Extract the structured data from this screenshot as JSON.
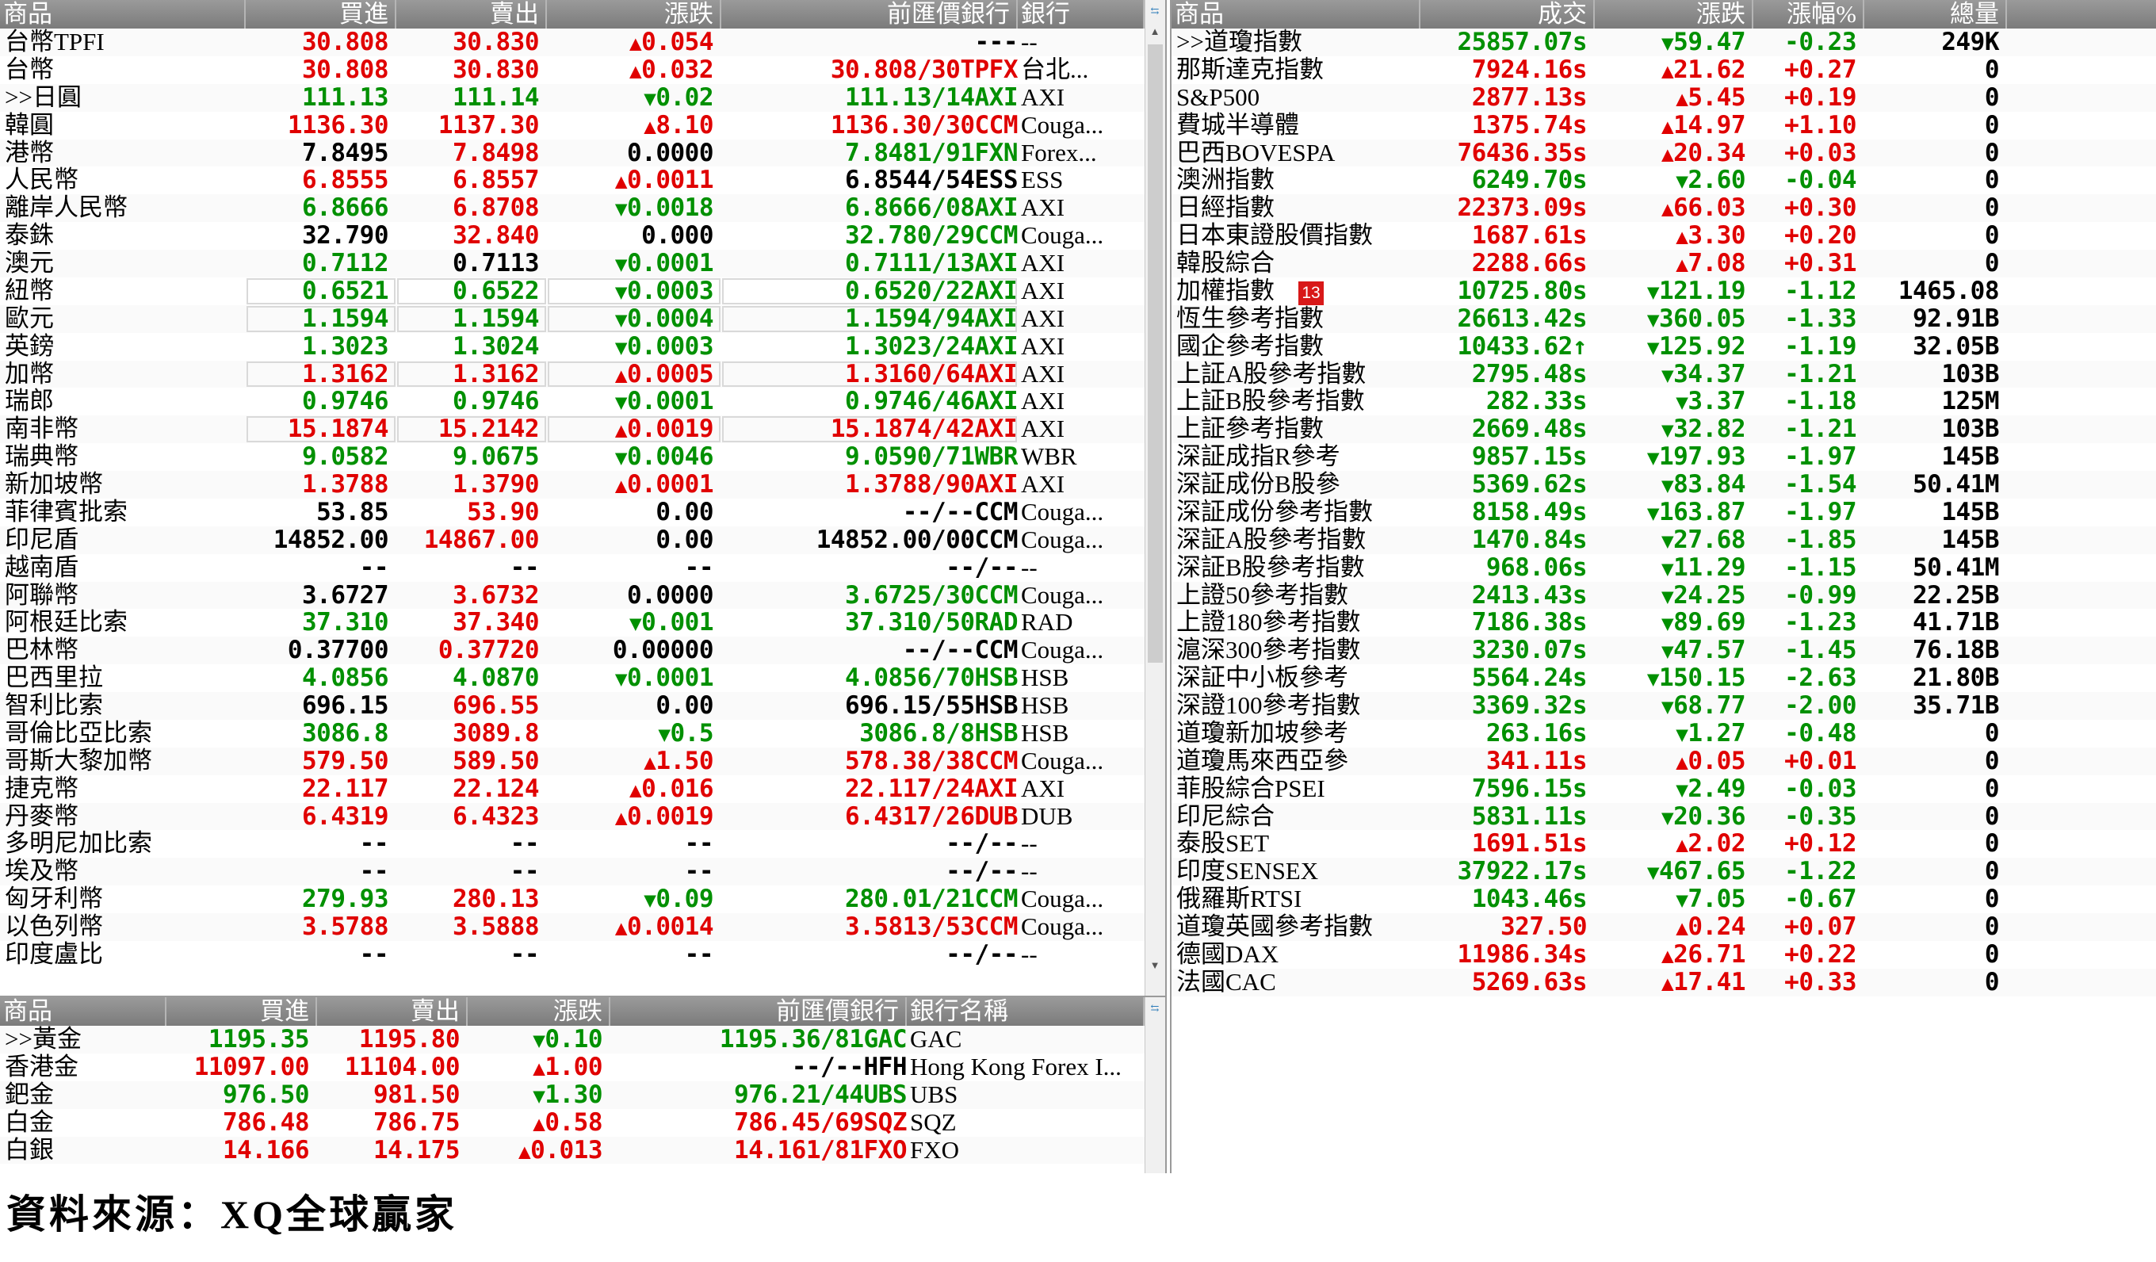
{
  "fx_panel": {
    "headers": {
      "name": "商品",
      "bid": "買進",
      "ask": "賣出",
      "change": "漲跌",
      "prev": "前匯價銀行",
      "bank": "銀行"
    },
    "rows": [
      {
        "name": "台幣TPFI",
        "bid": "30.808",
        "ask": "30.830",
        "chg": "0.054",
        "dir": "up",
        "prev": "---",
        "bank": "--",
        "bidc": "up",
        "askc": "up",
        "prevc": "fl"
      },
      {
        "name": "台幣",
        "bid": "30.808",
        "ask": "30.830",
        "chg": "0.032",
        "dir": "up",
        "prev": "30.808/30TPFX",
        "bank": "台北...",
        "bidc": "up",
        "askc": "up",
        "prevc": "up"
      },
      {
        "name": ">>日圓",
        "bid": "111.13",
        "ask": "111.14",
        "chg": "0.02",
        "dir": "dn",
        "prev": "111.13/14AXI",
        "bank": "AXI",
        "bidc": "dn",
        "askc": "dn",
        "prevc": "dn"
      },
      {
        "name": "韓圓",
        "bid": "1136.30",
        "ask": "1137.30",
        "chg": "8.10",
        "dir": "up",
        "prev": "1136.30/30CCM",
        "bank": "Couga...",
        "bidc": "up",
        "askc": "up",
        "prevc": "up"
      },
      {
        "name": "港幣",
        "bid": "7.8495",
        "ask": "7.8498",
        "chg": "0.0000",
        "dir": "fl",
        "prev": "7.8481/91FXN",
        "bank": "Forex...",
        "bidc": "fl",
        "askc": "up",
        "prevc": "dn"
      },
      {
        "name": "人民幣",
        "bid": "6.8555",
        "ask": "6.8557",
        "chg": "0.0011",
        "dir": "up",
        "prev": "6.8544/54ESS",
        "bank": "ESS",
        "bidc": "up",
        "askc": "up",
        "prevc": "fl"
      },
      {
        "name": "離岸人民幣",
        "bid": "6.8666",
        "ask": "6.8708",
        "chg": "0.0018",
        "dir": "dn",
        "prev": "6.8666/08AXI",
        "bank": "AXI",
        "bidc": "dn",
        "askc": "up",
        "prevc": "dn"
      },
      {
        "name": "泰銖",
        "bid": "32.790",
        "ask": "32.840",
        "chg": "0.000",
        "dir": "fl",
        "prev": "32.780/29CCM",
        "bank": "Couga...",
        "bidc": "fl",
        "askc": "up",
        "prevc": "dn"
      },
      {
        "name": "澳元",
        "bid": "0.7112",
        "ask": "0.7113",
        "chg": "0.0001",
        "dir": "dn",
        "prev": "0.7111/13AXI",
        "bank": "AXI",
        "bidc": "dn",
        "askc": "fl",
        "prevc": "dn"
      },
      {
        "name": "紐幣",
        "bid": "0.6521",
        "ask": "0.6522",
        "chg": "0.0003",
        "dir": "dn",
        "prev": "0.6520/22AXI",
        "bank": "AXI",
        "bidc": "dn",
        "askc": "dn",
        "prevc": "dn",
        "boxed": true
      },
      {
        "name": "歐元",
        "bid": "1.1594",
        "ask": "1.1594",
        "chg": "0.0004",
        "dir": "dn",
        "prev": "1.1594/94AXI",
        "bank": "AXI",
        "bidc": "dn",
        "askc": "dn",
        "prevc": "dn",
        "boxed": true
      },
      {
        "name": "英鎊",
        "bid": "1.3023",
        "ask": "1.3024",
        "chg": "0.0003",
        "dir": "dn",
        "prev": "1.3023/24AXI",
        "bank": "AXI",
        "bidc": "dn",
        "askc": "dn",
        "prevc": "dn"
      },
      {
        "name": "加幣",
        "bid": "1.3162",
        "ask": "1.3162",
        "chg": "0.0005",
        "dir": "up",
        "prev": "1.3160/64AXI",
        "bank": "AXI",
        "bidc": "up",
        "askc": "up",
        "prevc": "up",
        "boxed": true
      },
      {
        "name": "瑞郎",
        "bid": "0.9746",
        "ask": "0.9746",
        "chg": "0.0001",
        "dir": "dn",
        "prev": "0.9746/46AXI",
        "bank": "AXI",
        "bidc": "dn",
        "askc": "dn",
        "prevc": "dn"
      },
      {
        "name": "南非幣",
        "bid": "15.1874",
        "ask": "15.2142",
        "chg": "0.0019",
        "dir": "up",
        "prev": "15.1874/42AXI",
        "bank": "AXI",
        "bidc": "up",
        "askc": "up",
        "prevc": "up",
        "boxed": true
      },
      {
        "name": "瑞典幣",
        "bid": "9.0582",
        "ask": "9.0675",
        "chg": "0.0046",
        "dir": "dn",
        "prev": "9.0590/71WBR",
        "bank": "WBR",
        "bidc": "dn",
        "askc": "dn",
        "prevc": "dn"
      },
      {
        "name": "新加坡幣",
        "bid": "1.3788",
        "ask": "1.3790",
        "chg": "0.0001",
        "dir": "up",
        "prev": "1.3788/90AXI",
        "bank": "AXI",
        "bidc": "up",
        "askc": "up",
        "prevc": "up"
      },
      {
        "name": "菲律賓批索",
        "bid": "53.85",
        "ask": "53.90",
        "chg": "0.00",
        "dir": "fl",
        "prev": "--/--CCM",
        "bank": "Couga...",
        "bidc": "fl",
        "askc": "up",
        "prevc": "fl"
      },
      {
        "name": "印尼盾",
        "bid": "14852.00",
        "ask": "14867.00",
        "chg": "0.00",
        "dir": "fl",
        "prev": "14852.00/00CCM",
        "bank": "Couga...",
        "bidc": "fl",
        "askc": "up",
        "prevc": "fl"
      },
      {
        "name": "越南盾",
        "bid": "--",
        "ask": "--",
        "chg": "--",
        "dir": "fl",
        "prev": "--/--",
        "bank": "--",
        "bidc": "fl",
        "askc": "fl",
        "prevc": "fl"
      },
      {
        "name": "阿聯幣",
        "bid": "3.6727",
        "ask": "3.6732",
        "chg": "0.0000",
        "dir": "fl",
        "prev": "3.6725/30CCM",
        "bank": "Couga...",
        "bidc": "fl",
        "askc": "up",
        "prevc": "dn"
      },
      {
        "name": "阿根廷比索",
        "bid": "37.310",
        "ask": "37.340",
        "chg": "0.001",
        "dir": "dn",
        "prev": "37.310/50RAD",
        "bank": "RAD",
        "bidc": "dn",
        "askc": "up",
        "prevc": "dn"
      },
      {
        "name": "巴林幣",
        "bid": "0.37700",
        "ask": "0.37720",
        "chg": "0.00000",
        "dir": "fl",
        "prev": "--/--CCM",
        "bank": "Couga...",
        "bidc": "fl",
        "askc": "up",
        "prevc": "fl"
      },
      {
        "name": "巴西里拉",
        "bid": "4.0856",
        "ask": "4.0870",
        "chg": "0.0001",
        "dir": "dn",
        "prev": "4.0856/70HSB",
        "bank": "HSB",
        "bidc": "dn",
        "askc": "dn",
        "prevc": "dn"
      },
      {
        "name": "智利比索",
        "bid": "696.15",
        "ask": "696.55",
        "chg": "0.00",
        "dir": "fl",
        "prev": "696.15/55HSB",
        "bank": "HSB",
        "bidc": "fl",
        "askc": "up",
        "prevc": "fl"
      },
      {
        "name": "哥倫比亞比索",
        "bid": "3086.8",
        "ask": "3089.8",
        "chg": "0.5",
        "dir": "dn",
        "prev": "3086.8/8HSB",
        "bank": "HSB",
        "bidc": "dn",
        "askc": "up",
        "prevc": "dn"
      },
      {
        "name": "哥斯大黎加幣",
        "bid": "579.50",
        "ask": "589.50",
        "chg": "1.50",
        "dir": "up",
        "prev": "578.38/38CCM",
        "bank": "Couga...",
        "bidc": "up",
        "askc": "up",
        "prevc": "up"
      },
      {
        "name": "捷克幣",
        "bid": "22.117",
        "ask": "22.124",
        "chg": "0.016",
        "dir": "up",
        "prev": "22.117/24AXI",
        "bank": "AXI",
        "bidc": "up",
        "askc": "up",
        "prevc": "up"
      },
      {
        "name": "丹麥幣",
        "bid": "6.4319",
        "ask": "6.4323",
        "chg": "0.0019",
        "dir": "up",
        "prev": "6.4317/26DUB",
        "bank": "DUB",
        "bidc": "up",
        "askc": "up",
        "prevc": "up"
      },
      {
        "name": "多明尼加比索",
        "bid": "--",
        "ask": "--",
        "chg": "--",
        "dir": "fl",
        "prev": "--/--",
        "bank": "--",
        "bidc": "fl",
        "askc": "fl",
        "prevc": "fl"
      },
      {
        "name": "埃及幣",
        "bid": "--",
        "ask": "--",
        "chg": "--",
        "dir": "fl",
        "prev": "--/--",
        "bank": "--",
        "bidc": "fl",
        "askc": "fl",
        "prevc": "fl"
      },
      {
        "name": "匈牙利幣",
        "bid": "279.93",
        "ask": "280.13",
        "chg": "0.09",
        "dir": "dn",
        "prev": "280.01/21CCM",
        "bank": "Couga...",
        "bidc": "dn",
        "askc": "up",
        "prevc": "dn"
      },
      {
        "name": "以色列幣",
        "bid": "3.5788",
        "ask": "3.5888",
        "chg": "0.0014",
        "dir": "up",
        "prev": "3.5813/53CCM",
        "bank": "Couga...",
        "bidc": "up",
        "askc": "up",
        "prevc": "up"
      },
      {
        "name": "印度盧比",
        "bid": "--",
        "ask": "--",
        "chg": "--",
        "dir": "fl",
        "prev": "--/--",
        "bank": "--",
        "bidc": "fl",
        "askc": "fl",
        "prevc": "fl"
      }
    ]
  },
  "metal_panel": {
    "headers": {
      "name": "商品",
      "bid": "買進",
      "ask": "賣出",
      "change": "漲跌",
      "prev": "前匯價銀行",
      "bank": "銀行名稱"
    },
    "rows": [
      {
        "name": ">>黃金",
        "bid": "1195.35",
        "ask": "1195.80",
        "chg": "0.10",
        "dir": "dn",
        "prev": "1195.36/81GAC",
        "bank": "GAC",
        "bidc": "dn",
        "askc": "up",
        "prevc": "dn"
      },
      {
        "name": "香港金",
        "bid": "11097.00",
        "ask": "11104.00",
        "chg": "1.00",
        "dir": "up",
        "prev": "--/--HFH",
        "bank": "Hong Kong Forex I...",
        "bidc": "up",
        "askc": "up",
        "prevc": "fl"
      },
      {
        "name": "鈀金",
        "bid": "976.50",
        "ask": "981.50",
        "chg": "1.30",
        "dir": "dn",
        "prev": "976.21/44UBS",
        "bank": "UBS",
        "bidc": "dn",
        "askc": "up",
        "prevc": "dn"
      },
      {
        "name": "白金",
        "bid": "786.48",
        "ask": "786.75",
        "chg": "0.58",
        "dir": "up",
        "prev": "786.45/69SQZ",
        "bank": "SQZ",
        "bidc": "up",
        "askc": "up",
        "prevc": "up"
      },
      {
        "name": "白銀",
        "bid": "14.166",
        "ask": "14.175",
        "chg": "0.013",
        "dir": "up",
        "prev": "14.161/81FXO",
        "bank": "FXO",
        "bidc": "up",
        "askc": "up",
        "prevc": "up"
      }
    ]
  },
  "index_panel": {
    "headers": {
      "name": "商品",
      "last": "成交",
      "change": "漲跌",
      "pct": "漲幅%",
      "volume": "總量"
    },
    "rows": [
      {
        "name": ">>道瓊指數",
        "last": "25857.07s",
        "lc": "dn",
        "chg": "59.47",
        "dir": "dn",
        "pct": "-0.23",
        "vol": "249K"
      },
      {
        "name": "那斯達克指數",
        "last": "7924.16s",
        "lc": "up",
        "chg": "21.62",
        "dir": "up",
        "pct": "+0.27",
        "vol": "0"
      },
      {
        "name": "S&P500",
        "last": "2877.13s",
        "lc": "up",
        "chg": "5.45",
        "dir": "up",
        "pct": "+0.19",
        "vol": "0"
      },
      {
        "name": "費城半導體",
        "last": "1375.74s",
        "lc": "up",
        "chg": "14.97",
        "dir": "up",
        "pct": "+1.10",
        "vol": "0"
      },
      {
        "name": "巴西BOVESPA",
        "last": "76436.35s",
        "lc": "up",
        "chg": "20.34",
        "dir": "up",
        "pct": "+0.03",
        "vol": "0"
      },
      {
        "name": "澳洲指數",
        "last": "6249.70s",
        "lc": "dn",
        "chg": "2.60",
        "dir": "dn",
        "pct": "-0.04",
        "vol": "0"
      },
      {
        "name": "日經指數",
        "last": "22373.09s",
        "lc": "up",
        "chg": "66.03",
        "dir": "up",
        "pct": "+0.30",
        "vol": "0"
      },
      {
        "name": "日本東證股價指數",
        "last": "1687.61s",
        "lc": "up",
        "chg": "3.30",
        "dir": "up",
        "pct": "+0.20",
        "vol": "0"
      },
      {
        "name": "韓股綜合",
        "last": "2288.66s",
        "lc": "up",
        "chg": "7.08",
        "dir": "up",
        "pct": "+0.31",
        "vol": "0"
      },
      {
        "name": "加權指數",
        "badge": "13",
        "last": "10725.80s",
        "lc": "dn",
        "chg": "121.19",
        "dir": "dn",
        "pct": "-1.12",
        "vol": "1465.08"
      },
      {
        "name": "恆生參考指數",
        "last": "26613.42s",
        "lc": "dn",
        "chg": "360.05",
        "dir": "dn",
        "pct": "-1.33",
        "vol": "92.91B"
      },
      {
        "name": "國企參考指數",
        "last": "10433.62↑",
        "lc": "dn",
        "chg": "125.92",
        "dir": "dn",
        "pct": "-1.19",
        "vol": "32.05B"
      },
      {
        "name": "上証A股參考指數",
        "last": "2795.48s",
        "lc": "dn",
        "chg": "34.37",
        "dir": "dn",
        "pct": "-1.21",
        "vol": "103B"
      },
      {
        "name": "上証B股參考指數",
        "last": "282.33s",
        "lc": "dn",
        "chg": "3.37",
        "dir": "dn",
        "pct": "-1.18",
        "vol": "125M"
      },
      {
        "name": "上証參考指數",
        "last": "2669.48s",
        "lc": "dn",
        "chg": "32.82",
        "dir": "dn",
        "pct": "-1.21",
        "vol": "103B"
      },
      {
        "name": "深証成指R參考",
        "last": "9857.15s",
        "lc": "dn",
        "chg": "197.93",
        "dir": "dn",
        "pct": "-1.97",
        "vol": "145B"
      },
      {
        "name": "深証成份B股參",
        "last": "5369.62s",
        "lc": "dn",
        "chg": "83.84",
        "dir": "dn",
        "pct": "-1.54",
        "vol": "50.41M"
      },
      {
        "name": "深証成份參考指數",
        "last": "8158.49s",
        "lc": "dn",
        "chg": "163.87",
        "dir": "dn",
        "pct": "-1.97",
        "vol": "145B"
      },
      {
        "name": "深証A股參考指數",
        "last": "1470.84s",
        "lc": "dn",
        "chg": "27.68",
        "dir": "dn",
        "pct": "-1.85",
        "vol": "145B"
      },
      {
        "name": "深証B股參考指數",
        "last": "968.06s",
        "lc": "dn",
        "chg": "11.29",
        "dir": "dn",
        "pct": "-1.15",
        "vol": "50.41M"
      },
      {
        "name": "上證50參考指數",
        "last": "2413.43s",
        "lc": "dn",
        "chg": "24.25",
        "dir": "dn",
        "pct": "-0.99",
        "vol": "22.25B"
      },
      {
        "name": "上證180參考指數",
        "last": "7186.38s",
        "lc": "dn",
        "chg": "89.69",
        "dir": "dn",
        "pct": "-1.23",
        "vol": "41.71B"
      },
      {
        "name": "滬深300參考指數",
        "last": "3230.07s",
        "lc": "dn",
        "chg": "47.57",
        "dir": "dn",
        "pct": "-1.45",
        "vol": "76.18B"
      },
      {
        "name": "深証中小板參考",
        "last": "5564.24s",
        "lc": "dn",
        "chg": "150.15",
        "dir": "dn",
        "pct": "-2.63",
        "vol": "21.80B"
      },
      {
        "name": "深證100參考指數",
        "last": "3369.32s",
        "lc": "dn",
        "chg": "68.77",
        "dir": "dn",
        "pct": "-2.00",
        "vol": "35.71B"
      },
      {
        "name": "道瓊新加坡參考",
        "last": "263.16s",
        "lc": "dn",
        "chg": "1.27",
        "dir": "dn",
        "pct": "-0.48",
        "vol": "0"
      },
      {
        "name": "道瓊馬來西亞參",
        "last": "341.11s",
        "lc": "up",
        "chg": "0.05",
        "dir": "up",
        "pct": "+0.01",
        "vol": "0"
      },
      {
        "name": "菲股綜合PSEI",
        "last": "7596.15s",
        "lc": "dn",
        "chg": "2.49",
        "dir": "dn",
        "pct": "-0.03",
        "vol": "0"
      },
      {
        "name": "印尼綜合",
        "last": "5831.11s",
        "lc": "dn",
        "chg": "20.36",
        "dir": "dn",
        "pct": "-0.35",
        "vol": "0"
      },
      {
        "name": "泰股SET",
        "last": "1691.51s",
        "lc": "up",
        "chg": "2.02",
        "dir": "up",
        "pct": "+0.12",
        "vol": "0"
      },
      {
        "name": "印度SENSEX",
        "last": "37922.17s",
        "lc": "dn",
        "chg": "467.65",
        "dir": "dn",
        "pct": "-1.22",
        "vol": "0"
      },
      {
        "name": "俄羅斯RTSI",
        "last": "1043.46s",
        "lc": "dn",
        "chg": "7.05",
        "dir": "dn",
        "pct": "-0.67",
        "vol": "0"
      },
      {
        "name": "道瓊英國參考指數",
        "last": "327.50",
        "lc": "up",
        "chg": "0.24",
        "dir": "up",
        "pct": "+0.07",
        "vol": "0"
      },
      {
        "name": "德國DAX",
        "last": "11986.34s",
        "lc": "up",
        "chg": "26.71",
        "dir": "up",
        "pct": "+0.22",
        "vol": "0"
      },
      {
        "name": "法國CAC",
        "last": "5269.63s",
        "lc": "up",
        "chg": "17.41",
        "dir": "up",
        "pct": "+0.33",
        "vol": "0"
      }
    ]
  },
  "source_note": "資料來源：XQ全球贏家",
  "icons": {
    "up": "▲",
    "down": "▼",
    "scroll_up": "▲",
    "scroll_down": "▼",
    "link": "⇆"
  },
  "colors": {
    "up": "#e00000",
    "down": "#009000",
    "header": "#8a8a8a"
  }
}
